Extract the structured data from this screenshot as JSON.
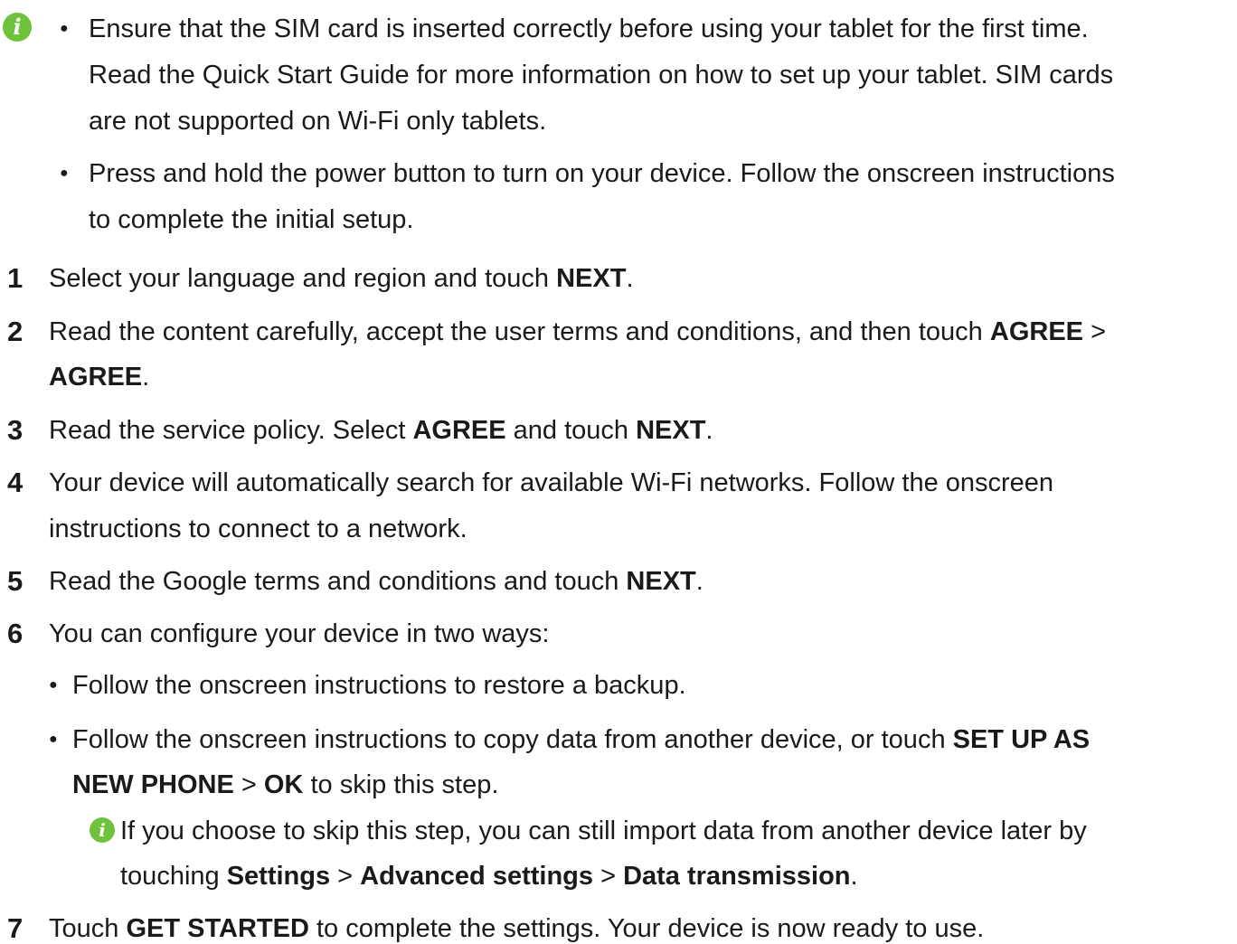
{
  "icons": {
    "info": "info-icon",
    "info_glyph": "i",
    "info_color": "#6fc23b"
  },
  "bullet_glyph": "●",
  "note": {
    "b1_l1": "Ensure that the SIM card is inserted correctly before using your tablet for the first time.",
    "b1_l2": "Read the Quick Start Guide for more information on how to set up your tablet. SIM cards",
    "b1_l3": "are not supported on Wi-Fi only tablets.",
    "b2_l1": "Press and hold the power button to turn on your device. Follow the onscreen instructions",
    "b2_l2": "to complete the initial setup."
  },
  "steps": {
    "s1": {
      "num": "1",
      "t1": "Select your language and region and touch ",
      "b1": "NEXT",
      "t2": "."
    },
    "s2": {
      "num": "2",
      "t1": "Read the content carefully, accept the user terms and conditions, and then touch ",
      "b1": "AGREE",
      "t2": " >",
      "b2": "AGREE",
      "t3": "."
    },
    "s3": {
      "num": "3",
      "t1": "Read the service policy. Select ",
      "b1": "AGREE",
      "t2": " and touch ",
      "b2": "NEXT",
      "t3": "."
    },
    "s4": {
      "num": "4",
      "l1": "Your device will automatically search for available Wi-Fi networks. Follow the onscreen",
      "l2": "instructions to connect to a network."
    },
    "s5": {
      "num": "5",
      "t1": "Read the Google terms and conditions and touch ",
      "b1": "NEXT",
      "t2": "."
    },
    "s6": {
      "num": "6",
      "text": "You can configure your device in two ways:",
      "opt1": "Follow the onscreen instructions to restore a backup.",
      "opt2_t1": "Follow the onscreen instructions to copy data from another device, or touch ",
      "opt2_b1": "SET UP AS",
      "opt2_b2": "NEW PHONE",
      "opt2_t2": " > ",
      "opt2_b3": "OK",
      "opt2_t3": " to skip this step.",
      "tip_t1": "If you choose to skip this step, you can still import data from another device later by",
      "tip_t2": "touching ",
      "tip_b1": "Settings",
      "tip_t3": " > ",
      "tip_b2": "Advanced settings",
      "tip_t4": " > ",
      "tip_b3": "Data transmission",
      "tip_t5": "."
    },
    "s7": {
      "num": "7",
      "t1": "Touch ",
      "b1": "GET STARTED",
      "t2": " to complete the settings. Your device is now ready to use."
    }
  }
}
